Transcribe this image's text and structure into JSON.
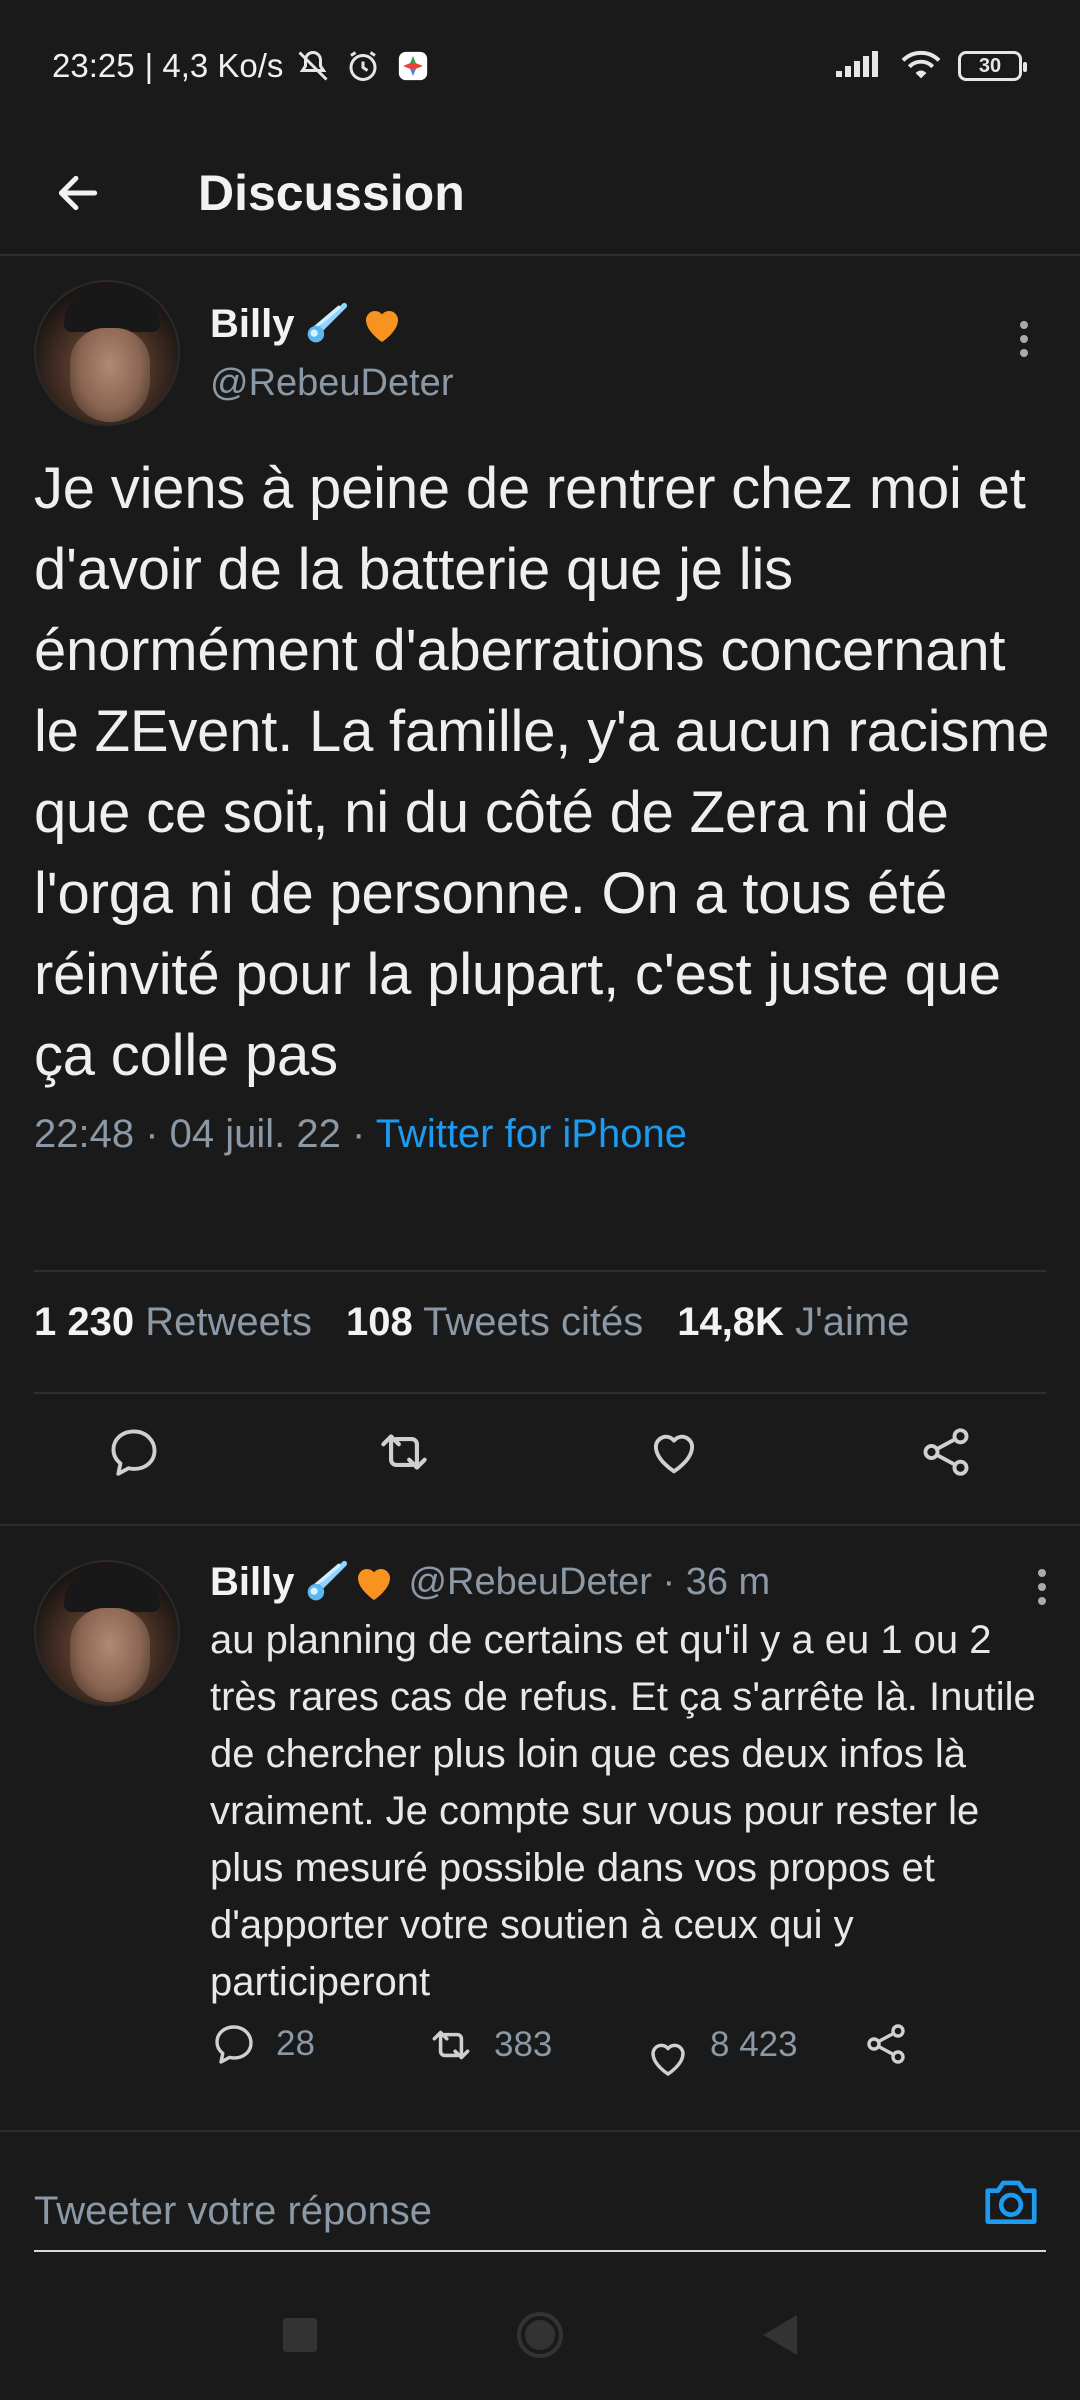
{
  "status_bar": {
    "time": "23:25",
    "speed": "| 4,3 Ko/s",
    "battery": "30",
    "icons": [
      "mute-icon",
      "alarm-icon",
      "app-icon",
      "signal-icon",
      "wifi-icon",
      "battery-icon"
    ]
  },
  "header": {
    "title": "Discussion",
    "back_icon": "arrow-left-icon"
  },
  "tweet": {
    "author_name": "Billy",
    "author_emojis": [
      "comet-icon",
      "orange-heart-icon"
    ],
    "author_handle": "@RebeuDeter",
    "text": "Je viens à peine de rentrer chez moi et d'avoir de la batterie que je lis énormément d'aberrations concernant le ZEvent. La famille, y'a aucun racisme que ce soit, ni du côté de Zera ni de l'orga ni de personne. On a tous été réinvité pour la plupart, c'est juste que ça colle pas",
    "timestamp": "22:48 · 04 juil. 22 · ",
    "source": "Twitter for iPhone",
    "stats": {
      "retweets_count": "1 230",
      "retweets_label": "Retweets",
      "quotes_count": "108",
      "quotes_label": "Tweets cités",
      "likes_count": "14,8K",
      "likes_label": "J'aime"
    },
    "actions": [
      "reply-icon",
      "retweet-icon",
      "like-icon",
      "share-icon"
    ]
  },
  "reply": {
    "author_name": "Billy",
    "author_handle": "@RebeuDeter · 36 m",
    "text": "au planning de certains et qu'il y a eu 1 ou 2 très rares cas de refus. Et ça s'arrête là. Inutile de chercher plus loin que ces deux infos là vraiment. Je compte sur vous pour rester le plus mesuré possible dans vos propos et d'apporter votre soutien à ceux qui y participeront",
    "reply_count": "28",
    "retweet_count": "383",
    "like_count": "8 423"
  },
  "compose": {
    "placeholder": "Tweeter votre réponse",
    "camera_icon": "camera-icon"
  },
  "colors": {
    "background": "#1a1a1a",
    "accent": "#1d9bf0",
    "muted": "#8b98a5",
    "heart_emoji": "#f7931e"
  }
}
